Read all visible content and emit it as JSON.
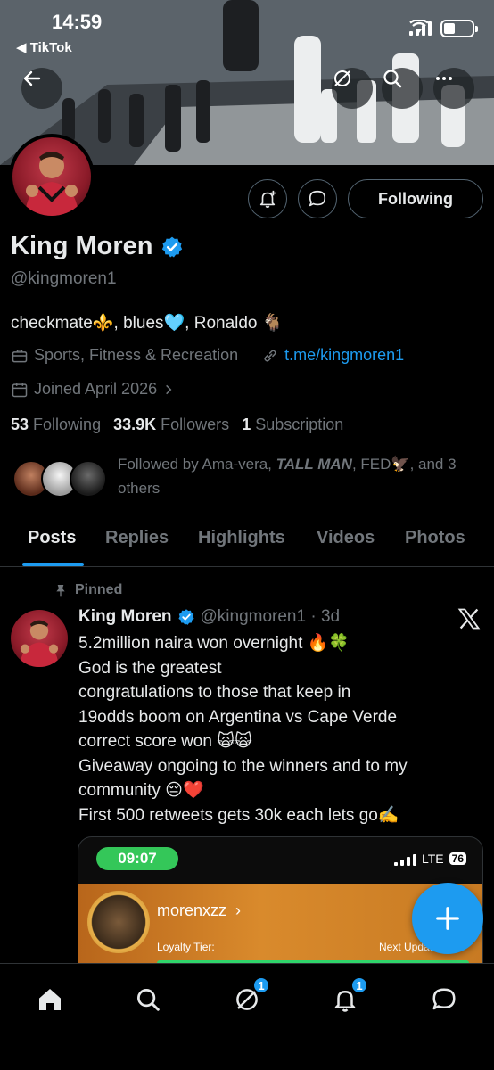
{
  "status_bar": {
    "time": "14:59",
    "back_app": "◀ TikTok"
  },
  "banner": {
    "description_icons": [
      "back-arrow-icon",
      "mute-icon",
      "search-icon",
      "more-icon"
    ]
  },
  "profile": {
    "following_label": "Following",
    "name": "King Moren",
    "handle": "@kingmoren1",
    "bio": "checkmate⚜️, blues🩵, Ronaldo 🐐",
    "category": "Sports, Fitness & Recreation",
    "link": "t.me/kingmoren1",
    "joined": "Joined April 2026",
    "following_count": "53",
    "following_text": "Following",
    "followers_count": "33.9K",
    "followers_text": "Followers",
    "subscription_count": "1",
    "subscription_text": "Subscription",
    "followed_by_prefix": "Followed by Ama-vera, ",
    "followed_by_bold": "TALL MAN",
    "followed_by_suffix": ", FED🦅, and 3 others"
  },
  "tabs": [
    "Posts",
    "Replies",
    "Highlights",
    "Videos",
    "Photos"
  ],
  "tweet": {
    "pinned_label": "Pinned",
    "author": "King Moren",
    "handle_time": "@kingmoren1 · 3d",
    "lines": [
      "5.2million naira won overnight 🔥🍀",
      "God is the greatest",
      "congratulations to those that keep in",
      "19odds boom on Argentina vs Cape Verde",
      "correct score won 🙀🙀",
      "Giveaway ongoing to the winners and to my",
      "community 😔❤️",
      "First 500 retweets gets 30k each lets go✍️"
    ],
    "media": {
      "time": "09:07",
      "network": "LTE",
      "battery": "76",
      "username": "morenxzz",
      "tier_label": "Loyalty Tier:",
      "next_label": "Next Upda..."
    }
  },
  "bottom_nav": {
    "messages_badge": "1",
    "notifications_badge": "1"
  },
  "colors": {
    "accent": "#1d9bf0",
    "background": "#000000",
    "muted": "#71767b",
    "text": "#e7e9ea"
  }
}
